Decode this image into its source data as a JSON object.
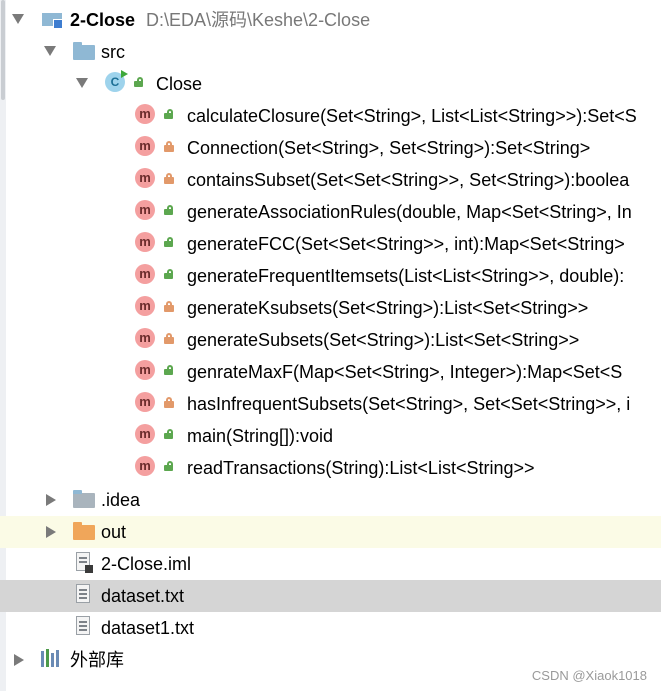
{
  "project": {
    "name": "2-Close",
    "path": "D:\\EDA\\源码\\Keshe\\2-Close"
  },
  "tree": {
    "src_label": "src",
    "class_label": "Close",
    "methods": [
      {
        "label": "calculateClosure(Set<String>, List<List<String>>):Set<S",
        "access": "public"
      },
      {
        "label": "Connection(Set<String>, Set<String>):Set<String>",
        "access": "private"
      },
      {
        "label": "containsSubset(Set<Set<String>>, Set<String>):boolea",
        "access": "private"
      },
      {
        "label": "generateAssociationRules(double, Map<Set<String>, In",
        "access": "public"
      },
      {
        "label": "generateFCC(Set<Set<String>>, int):Map<Set<String>",
        "access": "public"
      },
      {
        "label": "generateFrequentItemsets(List<List<String>>, double):",
        "access": "public"
      },
      {
        "label": "generateKsubsets(Set<String>):List<Set<String>>",
        "access": "private"
      },
      {
        "label": "generateSubsets(Set<String>):List<Set<String>>",
        "access": "private"
      },
      {
        "label": "genrateMaxF(Map<Set<String>, Integer>):Map<Set<S",
        "access": "public"
      },
      {
        "label": "hasInfrequentSubsets(Set<String>, Set<Set<String>>, i",
        "access": "private"
      },
      {
        "label": "main(String[]):void",
        "access": "public"
      },
      {
        "label": "readTransactions(String):List<List<String>>",
        "access": "public"
      }
    ],
    "idea_label": ".idea",
    "out_label": "out",
    "files": [
      {
        "label": "2-Close.iml"
      },
      {
        "label": "dataset.txt"
      },
      {
        "label": "dataset1.txt"
      }
    ],
    "external_libs_label": "外部库"
  },
  "watermark": "CSDN @Xiaok1018",
  "icons": {
    "method": "m",
    "class": "C"
  },
  "colors": {
    "selected_row": "#d5d5d5",
    "out_row": "#fbfbe6",
    "public_access": "#5ca74f",
    "private_access": "#e2996a"
  }
}
